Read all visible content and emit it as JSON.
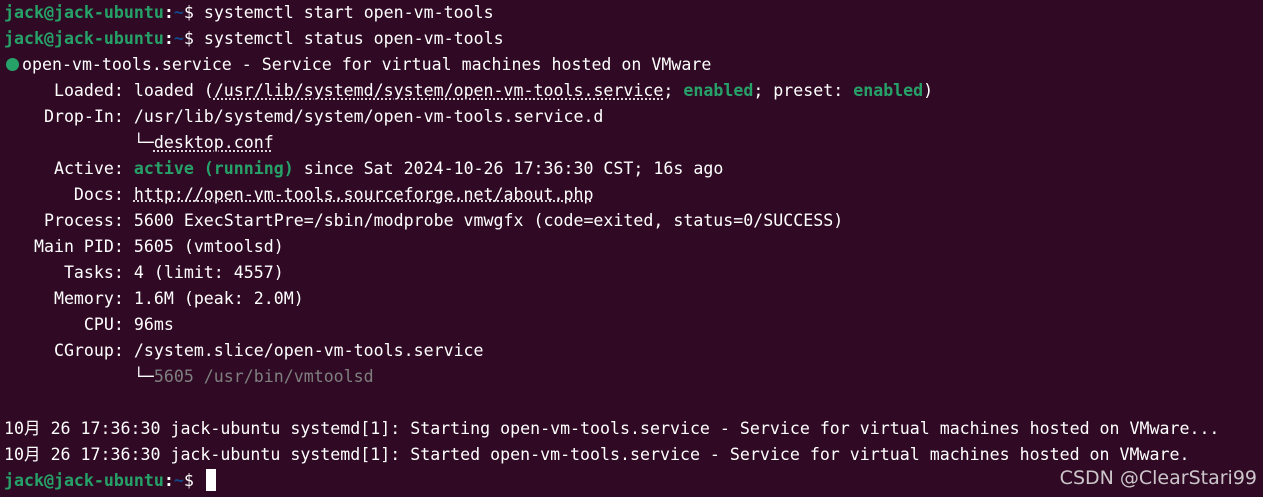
{
  "prompt": {
    "user_host": "jack@jack-ubuntu",
    "sep": ":",
    "path": "~",
    "symbol": "$"
  },
  "commands": [
    " systemctl start open-vm-tools",
    " systemctl status open-vm-tools"
  ],
  "status": {
    "header": "open-vm-tools.service - Service for virtual machines hosted on VMware",
    "loaded_label": "     Loaded: ",
    "loaded_a": "loaded (",
    "loaded_path": "/usr/lib/systemd/system/open-vm-tools.service",
    "loaded_b": "; ",
    "loaded_enabled": "enabled",
    "loaded_c": "; preset: ",
    "loaded_preset": "enabled",
    "loaded_d": ")",
    "dropin_label": "    Drop-In: ",
    "dropin_path": "/usr/lib/systemd/system/open-vm-tools.service.d",
    "dropin_tree": "             └─",
    "dropin_file": "desktop.conf",
    "active_label": "     Active: ",
    "active_state": "active (running)",
    "active_since": " since Sat 2024-10-26 17:36:30 CST; 16s ago",
    "docs_label": "       Docs: ",
    "docs_url": "http://open-vm-tools.sourceforge.net/about.php",
    "process_label": "    Process: ",
    "process_value": "5600 ExecStartPre=/sbin/modprobe vmwgfx (code=exited, status=0/SUCCESS)",
    "mainpid_label": "   Main PID: ",
    "mainpid_value": "5605 (vmtoolsd)",
    "tasks_label": "      Tasks: ",
    "tasks_value": "4 (limit: 4557)",
    "memory_label": "     Memory: ",
    "memory_value": "1.6M (peak: 2.0M)",
    "cpu_label": "        CPU: ",
    "cpu_value": "96ms",
    "cgroup_label": "     CGroup: ",
    "cgroup_value": "/system.slice/open-vm-tools.service",
    "cgroup_tree": "             └─",
    "cgroup_proc": "5605 /usr/bin/vmtoolsd"
  },
  "logs": [
    "10月 26 17:36:30 jack-ubuntu systemd[1]: Starting open-vm-tools.service - Service for virtual machines hosted on VMware...",
    "10月 26 17:36:30 jack-ubuntu systemd[1]: Started open-vm-tools.service - Service for virtual machines hosted on VMware."
  ],
  "watermark": "CSDN @ClearStari99",
  "colors": {
    "background": "#300a24",
    "prompt_green": "#26a269",
    "prompt_path": "#12488b",
    "active": "#26a269"
  }
}
